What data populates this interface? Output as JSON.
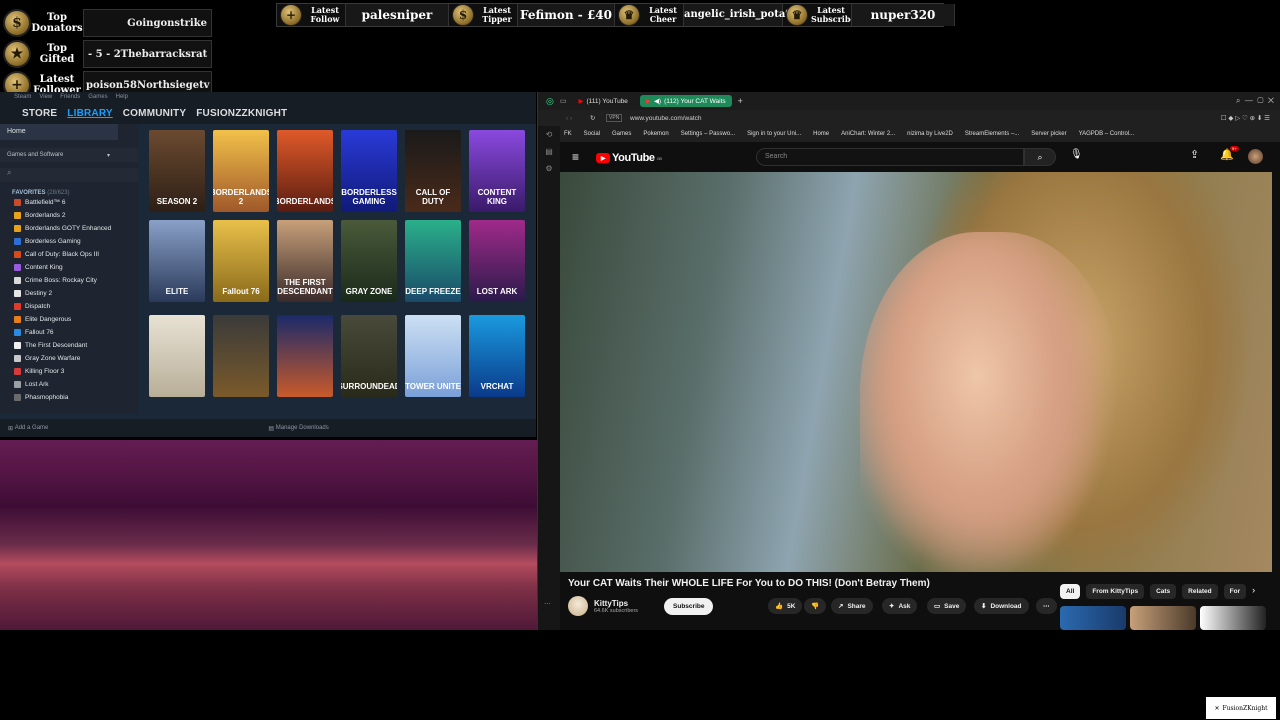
{
  "overlay": {
    "donors": [
      {
        "label": "Top Donators",
        "value": "Goingonstrike"
      },
      {
        "label": "Top Gifted",
        "prefix": "- 5   - 2",
        "value": "Thebarracksrat"
      },
      {
        "label": "Latest Follower",
        "prefix": "poison58",
        "value": "Northsiegetv  I"
      }
    ],
    "banner": [
      {
        "label": "Latest Follow",
        "value": "palesniper",
        "icon": "plus-coin-icon"
      },
      {
        "label": "Latest Tipper",
        "value": "Fefimon - £40",
        "icon": "dollar-coin-icon"
      },
      {
        "label": "Latest Cheer",
        "value": "angelic_irish_potato",
        "icon": "cheer-coin-icon"
      },
      {
        "label": "Latest Subscriber",
        "value": "nuper320",
        "icon": "sub-coin-icon"
      }
    ],
    "watermark": "FusionZKnight"
  },
  "steam": {
    "menu": [
      "Steam",
      "View",
      "Friends",
      "Games",
      "Help"
    ],
    "nav": [
      "STORE",
      "LIBRARY",
      "COMMUNITY",
      "FUSIONZZKNIGHT"
    ],
    "home": "Home",
    "filter": "Games and Software",
    "favorites_header": "FAVORITES",
    "favorites_count": "(28/623)",
    "games": [
      {
        "name": "Battlefield™ 6",
        "color": "#c94b2a"
      },
      {
        "name": "Borderlands 2",
        "color": "#e8a21a"
      },
      {
        "name": "Borderlands GOTY Enhanced",
        "color": "#e8a21a"
      },
      {
        "name": "Borderless Gaming",
        "color": "#2d6fd8"
      },
      {
        "name": "Call of Duty: Black Ops III",
        "color": "#d84a1a"
      },
      {
        "name": "Content King",
        "color": "#9a5adf"
      },
      {
        "name": "Crime Boss: Rockay City",
        "color": "#d9d9d9"
      },
      {
        "name": "Destiny 2",
        "color": "#e6e6e6"
      },
      {
        "name": "Dispatch",
        "color": "#e03a2a"
      },
      {
        "name": "Elite Dangerous",
        "color": "#e67e1a"
      },
      {
        "name": "Fallout 76",
        "color": "#2a8adf"
      },
      {
        "name": "The First Descendant",
        "color": "#f0f0f0"
      },
      {
        "name": "Gray Zone Warfare",
        "color": "#c8c8c8"
      },
      {
        "name": "Killing Floor 3",
        "color": "#d83a3a"
      },
      {
        "name": "Lost Ark",
        "color": "#9aa0a6"
      },
      {
        "name": "Phasmophobia",
        "color": "#6a6a6a"
      }
    ],
    "tiles": [
      {
        "title": "SEASON 2",
        "bg": "linear-gradient(180deg,#6b4a30,#2d1f16)"
      },
      {
        "title": "BORDERLANDS 2",
        "bg": "linear-gradient(180deg,#f2c14a,#a0582a)"
      },
      {
        "title": "BORDERLANDS",
        "bg": "linear-gradient(180deg,#e05a2a,#5a1c10)"
      },
      {
        "title": "BORDERLESS GAMING",
        "bg": "linear-gradient(180deg,#2a3ad8,#101a78)"
      },
      {
        "title": "CALL OF DUTY",
        "bg": "linear-gradient(180deg,#1a1a1a,#4a2a1a)"
      },
      {
        "title": "CONTENT KING",
        "bg": "linear-gradient(180deg,#8a4adf,#3a1a6a)"
      },
      {
        "title": "ELITE",
        "bg": "linear-gradient(180deg,#8aa0c8,#2a3a5a)"
      },
      {
        "title": "Fallout 76",
        "bg": "linear-gradient(180deg,#e8c04a,#8a6a1a)"
      },
      {
        "title": "THE FIRST DESCENDANT",
        "bg": "linear-gradient(180deg,#c8a07a,#3a2a2a)"
      },
      {
        "title": "GRAY ZONE",
        "bg": "linear-gradient(180deg,#4a5a3a,#1a2a1a)"
      },
      {
        "title": "DEEP FREEZE",
        "bg": "linear-gradient(180deg,#2ab08a,#1a4a6a)"
      },
      {
        "title": "LOST ARK",
        "bg": "linear-gradient(180deg,#a02a8a,#2a1a4a)"
      },
      {
        "title": "",
        "bg": "linear-gradient(180deg,#e8e2d4,#b8ae98)"
      },
      {
        "title": "",
        "bg": "linear-gradient(180deg,#3a3a3a,#7a5a2a)"
      },
      {
        "title": "",
        "bg": "linear-gradient(180deg,#1a2a6a,#c85a2a)"
      },
      {
        "title": "SURROUNDEAD",
        "bg": "linear-gradient(180deg,#4a4a3a,#2a2a1a)"
      },
      {
        "title": "TOWER UNITE",
        "bg": "linear-gradient(180deg,#cde0f4,#7aa0d8)"
      },
      {
        "title": "VRCHAT",
        "bg": "linear-gradient(180deg,#1a9adf,#0a3a8a)"
      }
    ],
    "footer_add": "Add a Game",
    "footer_downloads": "Manage Downloads"
  },
  "browser": {
    "tabs": [
      {
        "label": "(111) YouTube",
        "active": false
      },
      {
        "label": "(112) Your CAT Waits",
        "active": true
      }
    ],
    "url": "www.youtube.com/watch",
    "bookmarks": [
      "FK",
      "Social",
      "Games",
      "Pokemon",
      "Settings – Passwo...",
      "Sign in to your Uni...",
      "Home",
      "AniChart: Winter 2...",
      "nizima by Live2D",
      "StreamElements –...",
      "Server picker",
      "YAGPDB – Control..."
    ],
    "youtube": {
      "logo": "YouTube",
      "region": "GB",
      "search_placeholder": "Search",
      "notif_count": "9+",
      "title": "Your CAT Waits Their WHOLE LIFE For You to DO THIS! (Don't Betray Them)",
      "channel": "KittyTips",
      "subscribers": "64.6K subscribers",
      "subscribe": "Subscribe",
      "likes": "5K",
      "share": "Share",
      "ask": "Ask",
      "save": "Save",
      "download": "Download",
      "chips": [
        "All",
        "From KittyTips",
        "Cats",
        "Related",
        "For"
      ]
    }
  }
}
